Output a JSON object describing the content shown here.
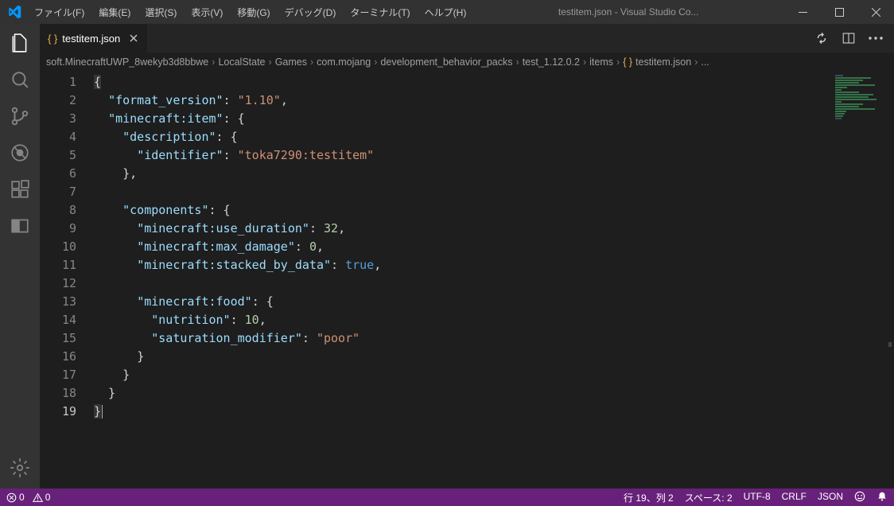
{
  "window": {
    "title": "testitem.json - Visual Studio Co..."
  },
  "menu": {
    "file": "ファイル(F)",
    "edit": "編集(E)",
    "select": "選択(S)",
    "view": "表示(V)",
    "go": "移動(G)",
    "debug": "デバッグ(D)",
    "terminal": "ターミナル(T)",
    "help": "ヘルプ(H)"
  },
  "tab": {
    "filename": "testitem.json"
  },
  "breadcrumbs": {
    "p0": "soft.MinecraftUWP_8wekyb3d8bbwe",
    "p1": "LocalState",
    "p2": "Games",
    "p3": "com.mojang",
    "p4": "development_behavior_packs",
    "p5": "test_1.12.0.2",
    "p6": "items",
    "p7": "testitem.json",
    "ell": "..."
  },
  "code": {
    "format_version_k": "\"format_version\"",
    "format_version_v": "\"1.10\"",
    "minecraft_item_k": "\"minecraft:item\"",
    "description_k": "\"description\"",
    "identifier_k": "\"identifier\"",
    "identifier_v": "\"toka7290:testitem\"",
    "components_k": "\"components\"",
    "use_duration_k": "\"minecraft:use_duration\"",
    "use_duration_v": "32",
    "max_damage_k": "\"minecraft:max_damage\"",
    "max_damage_v": "0",
    "stacked_k": "\"minecraft:stacked_by_data\"",
    "stacked_v": "true",
    "food_k": "\"minecraft:food\"",
    "nutrition_k": "\"nutrition\"",
    "nutrition_v": "10",
    "sat_k": "\"saturation_modifier\"",
    "sat_v": "\"poor\""
  },
  "status": {
    "errors": "0",
    "warnings": "0",
    "lncol": "行 19、列 2",
    "spaces": "スペース: 2",
    "encoding": "UTF-8",
    "eol": "CRLF",
    "lang": "JSON"
  }
}
